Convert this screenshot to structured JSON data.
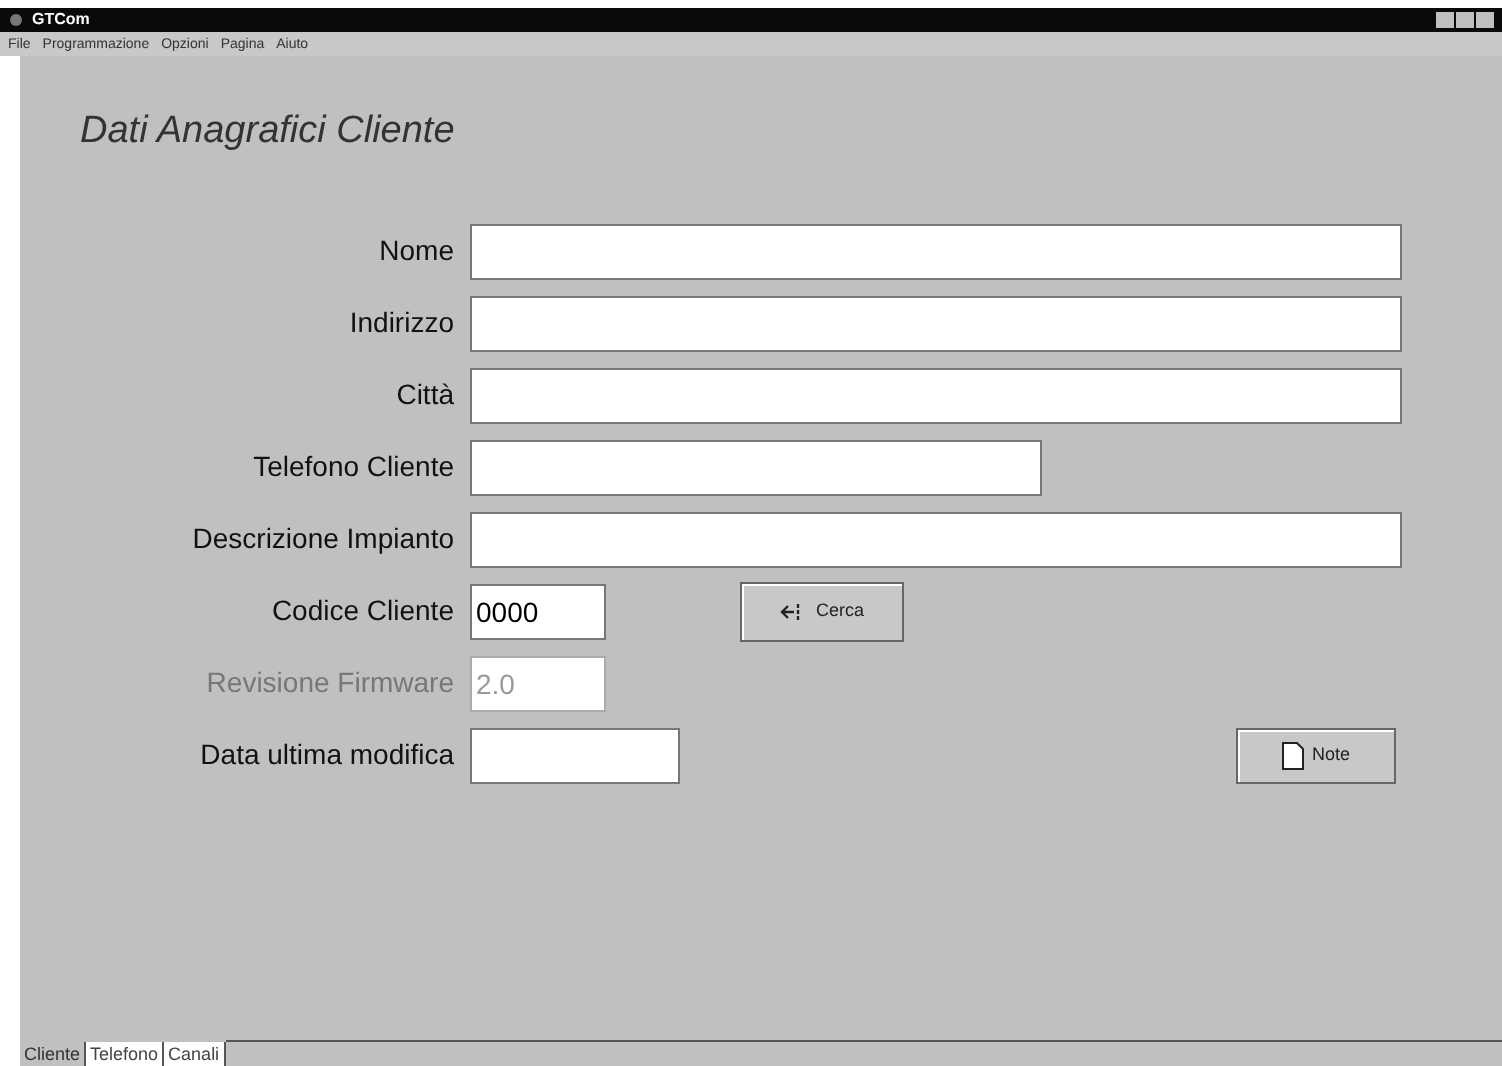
{
  "window": {
    "title": "GTCom"
  },
  "menu": [
    "File",
    "Programmazione",
    "Opzioni",
    "Pagina",
    "Aiuto"
  ],
  "heading": "Dati Anagrafici Cliente",
  "fields": [
    {
      "label": "Nome",
      "disabled": false
    },
    {
      "label": "Indirizzo",
      "disabled": false
    },
    {
      "label": "Città",
      "disabled": false
    },
    {
      "label": "Telefono Cliente",
      "disabled": false
    },
    {
      "label": "Descrizione Impianto",
      "disabled": false
    },
    {
      "label": "Codice Cliente",
      "value": "0000",
      "disabled": false,
      "button": "Cerca"
    },
    {
      "label": "Revisione Firmware",
      "value": "2.0",
      "disabled": true
    },
    {
      "label": "Data ultima modifica",
      "disabled": false,
      "button": "Note"
    }
  ],
  "tabs": [
    {
      "label": "Cliente",
      "selected": true
    },
    {
      "label": "Telefono",
      "selected": false
    },
    {
      "label": "Canali",
      "selected": false
    }
  ]
}
